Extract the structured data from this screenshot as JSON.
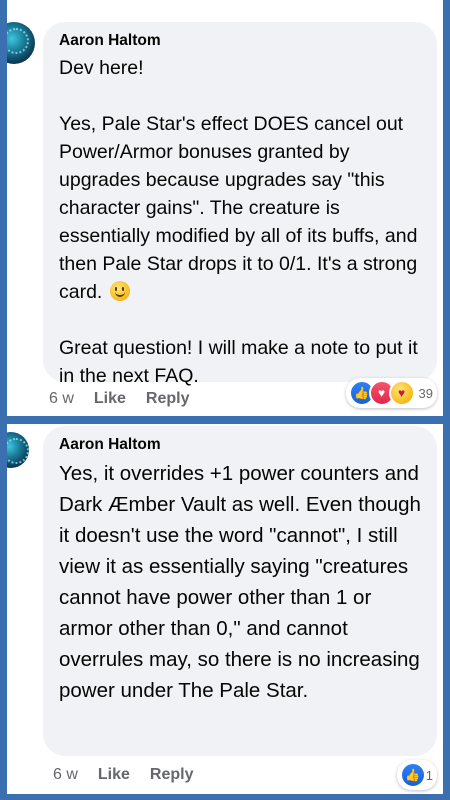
{
  "comments": [
    {
      "author": "Aaron Haltom",
      "text_main": "Dev here!\n\nYes, Pale Star's effect DOES cancel out Power/Armor bonuses granted by upgrades because upgrades say \"this character gains\". The creature is essentially modified by all of its buffs, and then Pale Star drops it to 0/1. It's a strong card. ",
      "emoji": "slightly-smiling-face-icon",
      "text_tail": "\n\nGreat question! I will make a note to put it in the next FAQ.",
      "time": "6 w",
      "like_label": "Like",
      "reply_label": "Reply",
      "reactions": [
        "like-icon",
        "love-icon",
        "care-icon"
      ],
      "reaction_count": "39"
    },
    {
      "author": "Aaron Haltom",
      "text_main": "Yes, it overrides +1 power counters and Dark Æmber Vault as well. Even though it doesn't use the word \"cannot\", I still view it as essentially saying \"creatures cannot have power other than 1 or armor other than 0,\" and cannot overrules may, so there is no increasing power under The Pale Star.",
      "time": "6 w",
      "like_label": "Like",
      "reply_label": "Reply",
      "reactions": [
        "like-icon"
      ],
      "reaction_count": "1"
    }
  ],
  "colors": {
    "background": "#3a6fb0",
    "bubble": "#f0f2f5",
    "secondary_text": "#65676b",
    "like_blue": "#1877f2"
  }
}
